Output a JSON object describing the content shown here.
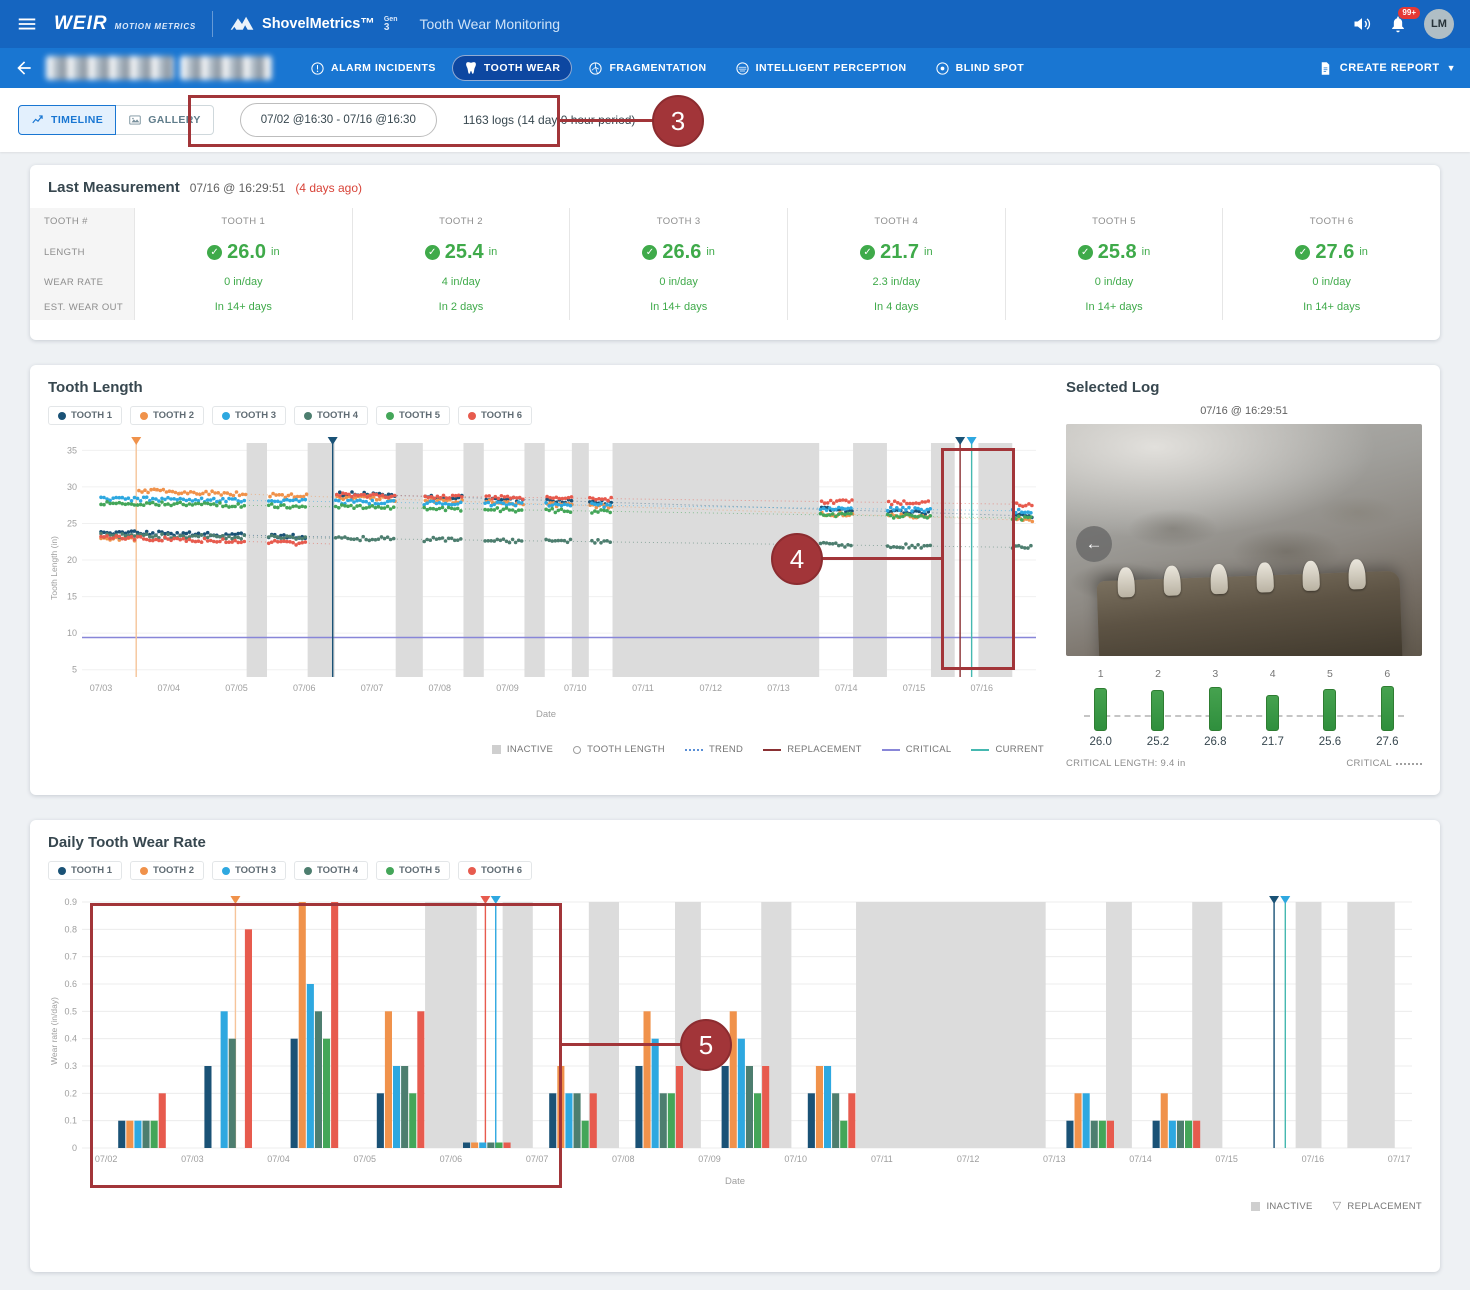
{
  "header": {
    "brand": "WEIR",
    "brand_sub": "MOTION METRICS",
    "product": "ShovelMetrics™",
    "product_gen_top": "Gen",
    "product_gen_num": "3",
    "page_title": "Tooth Wear Monitoring",
    "notification_badge": "99+",
    "avatar_initials": "LM"
  },
  "nav": {
    "items": [
      {
        "label": "ALARM INCIDENTS",
        "selected": false
      },
      {
        "label": "TOOTH WEAR",
        "selected": true
      },
      {
        "label": "FRAGMENTATION",
        "selected": false
      },
      {
        "label": "INTELLIGENT PERCEPTION",
        "selected": false
      },
      {
        "label": "BLIND SPOT",
        "selected": false
      }
    ],
    "create_report_label": "CREATE REPORT"
  },
  "toolbar": {
    "timeline_label": "TIMELINE",
    "gallery_label": "GALLERY",
    "date_range": "07/02 @16:30 - 07/16 @16:30",
    "log_summary": "1163 logs (14 day 0 hour period)"
  },
  "last_measurement": {
    "title": "Last Measurement",
    "timestamp": "07/16 @ 16:29:51",
    "ago": "(4 days ago)",
    "row_labels": [
      "TOOTH #",
      "LENGTH",
      "WEAR RATE",
      "EST. WEAR OUT"
    ],
    "teeth": [
      {
        "name": "TOOTH 1",
        "length": "26.0",
        "unit": "in",
        "rate": "0 in/day",
        "wearout": "In 14+ days"
      },
      {
        "name": "TOOTH 2",
        "length": "25.4",
        "unit": "in",
        "rate": "4 in/day",
        "wearout": "In 2 days"
      },
      {
        "name": "TOOTH 3",
        "length": "26.6",
        "unit": "in",
        "rate": "0 in/day",
        "wearout": "In 14+ days"
      },
      {
        "name": "TOOTH 4",
        "length": "21.7",
        "unit": "in",
        "rate": "2.3 in/day",
        "wearout": "In 4 days"
      },
      {
        "name": "TOOTH 5",
        "length": "25.8",
        "unit": "in",
        "rate": "0 in/day",
        "wearout": "In 14+ days"
      },
      {
        "name": "TOOTH 6",
        "length": "27.6",
        "unit": "in",
        "rate": "0 in/day",
        "wearout": "In 14+ days"
      }
    ]
  },
  "selected_log": {
    "title": "Selected Log",
    "timestamp": "07/16 @ 16:29:51",
    "teeth": [
      {
        "num": "1",
        "value": "26.0"
      },
      {
        "num": "2",
        "value": "25.2"
      },
      {
        "num": "3",
        "value": "26.8"
      },
      {
        "num": "4",
        "value": "21.7"
      },
      {
        "num": "5",
        "value": "25.6"
      },
      {
        "num": "6",
        "value": "27.6"
      }
    ],
    "critical_length": "CRITICAL LENGTH: 9.4 in",
    "critical_label": "CRITICAL"
  },
  "annotations": {
    "color": "#a23539",
    "labels": [
      "3",
      "4",
      "5"
    ]
  },
  "chart_data": [
    {
      "id": "tooth_length",
      "type": "scatter",
      "title": "Tooth Length",
      "xlabel": "Date",
      "ylabel": "Tooth Length (in)",
      "x_domain": [
        2.72,
        16.8
      ],
      "y_domain": [
        4,
        36
      ],
      "y_ticks": [
        5,
        10,
        15,
        20,
        25,
        30,
        35
      ],
      "x_tick_days": [
        3,
        4,
        5,
        6,
        7,
        8,
        9,
        10,
        11,
        12,
        13,
        14,
        15,
        16
      ],
      "x_tick_labels": [
        "07/03",
        "07/04",
        "07/05",
        "07/06",
        "07/07",
        "07/08",
        "07/09",
        "07/10",
        "07/11",
        "07/12",
        "07/13",
        "07/14",
        "07/15",
        "07/16"
      ],
      "critical_value": 9.4,
      "critical_color": "#8886d8",
      "current_x": 15.85,
      "inactive_color": "#dcdcdc",
      "inactive_bands": [
        [
          5.15,
          5.45
        ],
        [
          6.05,
          6.45
        ],
        [
          7.35,
          7.75
        ],
        [
          8.35,
          8.65
        ],
        [
          9.25,
          9.55
        ],
        [
          9.95,
          10.2
        ],
        [
          10.55,
          13.6
        ],
        [
          14.1,
          14.6
        ],
        [
          15.25,
          15.6
        ],
        [
          15.95,
          16.45
        ]
      ],
      "point_gaps": [
        [
          15.6,
          15.95
        ]
      ],
      "markers": [
        {
          "x": 3.52,
          "tri": "#f0924b",
          "line": "#f6c49a"
        },
        {
          "x": 6.42,
          "tri": "#1a5276",
          "line": "#1a5276"
        },
        {
          "x": 15.68,
          "tri": "#1a5276",
          "line": "#8a3033"
        },
        {
          "x": 15.85,
          "tri": "#2ea8e0",
          "line": "#45b8b0"
        }
      ],
      "series": [
        {
          "name": "TOOTH 1",
          "color": "#1a5276",
          "segments": [
            [
              3.0,
              23.8,
              6.4,
              23.15
            ],
            [
              6.48,
              29.1,
              16.75,
              26.0
            ]
          ]
        },
        {
          "name": "TOOTH 2",
          "color": "#f0924b",
          "segments": [
            [
              3.0,
              22.9,
              3.5,
              22.85
            ],
            [
              3.56,
              29.5,
              16.75,
              25.4
            ]
          ]
        },
        {
          "name": "TOOTH 3",
          "color": "#2ea8e0",
          "segments": [
            [
              3.0,
              28.4,
              16.75,
              26.7
            ]
          ]
        },
        {
          "name": "TOOTH 4",
          "color": "#4d7e6f",
          "segments": [
            [
              3.0,
              23.4,
              16.75,
              21.7
            ]
          ]
        },
        {
          "name": "TOOTH 5",
          "color": "#44a659",
          "segments": [
            [
              3.0,
              27.8,
              16.75,
              25.7
            ]
          ]
        },
        {
          "name": "TOOTH 6",
          "color": "#e75b4e",
          "segments": [
            [
              3.0,
              23.1,
              6.4,
              22.2
            ],
            [
              6.48,
              28.9,
              16.75,
              27.6
            ]
          ]
        }
      ],
      "legend_bottom": [
        {
          "glyph": "square",
          "label": "INACTIVE"
        },
        {
          "glyph": "circle",
          "label": "TOOTH LENGTH"
        },
        {
          "glyph": "dotted",
          "label": "TREND"
        },
        {
          "glyph": "line-dark",
          "label": "REPLACEMENT"
        },
        {
          "glyph": "line-purple",
          "label": "CRITICAL"
        },
        {
          "glyph": "line-teal",
          "label": "CURRENT"
        }
      ]
    },
    {
      "id": "wear_rate",
      "type": "bar",
      "title": "Daily Tooth Wear Rate",
      "xlabel": "Date",
      "ylabel": "Wear rate (in/day)",
      "x_domain": [
        1.72,
        17.15
      ],
      "y_domain": [
        0,
        0.9
      ],
      "y_ticks": [
        0,
        0.1,
        0.2,
        0.3,
        0.4,
        0.5,
        0.6,
        0.7,
        0.8,
        0.9
      ],
      "inactive_color": "#dcdcdc",
      "categories": [
        "07/02",
        "07/03",
        "07/04",
        "07/05",
        "07/06",
        "07/07",
        "07/08",
        "07/09",
        "07/10",
        "07/11",
        "07/12",
        "07/13",
        "07/14",
        "07/15",
        "07/16",
        "07/17"
      ],
      "inactive_bands": [
        [
          5.7,
          6.3
        ],
        [
          6.6,
          6.95
        ],
        [
          7.6,
          7.95
        ],
        [
          8.6,
          8.9
        ],
        [
          9.6,
          9.95
        ],
        [
          10.7,
          12.9
        ],
        [
          13.6,
          13.9
        ],
        [
          14.6,
          14.95
        ],
        [
          15.8,
          16.1
        ],
        [
          16.4,
          16.95
        ]
      ],
      "markers": [
        {
          "x": 3.5,
          "tri": "#f0924b",
          "line": "#f6c49a"
        },
        {
          "x": 6.4,
          "tri": "#e75b4e",
          "line": "#e75b4e"
        },
        {
          "x": 6.52,
          "tri": "#2ea8e0",
          "line": "#2ea8e0"
        },
        {
          "x": 15.55,
          "tri": "#1a5276",
          "line": "#1a5276"
        },
        {
          "x": 15.68,
          "tri": "#2ea8e0",
          "line": "#45b8b0"
        }
      ],
      "series": [
        {
          "name": "TOOTH 1",
          "color": "#1a5276",
          "values": [
            0.1,
            0.3,
            0.4,
            0.2,
            0.02,
            0.2,
            0.3,
            0.3,
            0.2,
            0,
            0,
            0.1,
            0.1,
            0,
            0,
            0
          ]
        },
        {
          "name": "TOOTH 2",
          "color": "#f0924b",
          "values": [
            0.1,
            0,
            0.9,
            0.5,
            0.02,
            0.3,
            0.5,
            0.5,
            0.3,
            0,
            0,
            0.2,
            0.2,
            0,
            0,
            0
          ]
        },
        {
          "name": "TOOTH 3",
          "color": "#2ea8e0",
          "values": [
            0.1,
            0.5,
            0.6,
            0.3,
            0.02,
            0.2,
            0.4,
            0.4,
            0.3,
            0,
            0,
            0.2,
            0.1,
            0,
            0,
            0
          ]
        },
        {
          "name": "TOOTH 4",
          "color": "#4d7e6f",
          "values": [
            0.1,
            0.4,
            0.5,
            0.3,
            0.02,
            0.2,
            0.2,
            0.3,
            0.2,
            0,
            0,
            0.1,
            0.1,
            0,
            0,
            0
          ]
        },
        {
          "name": "TOOTH 5",
          "color": "#44a659",
          "values": [
            0.1,
            0,
            0.4,
            0.2,
            0.02,
            0.1,
            0.2,
            0.2,
            0.1,
            0,
            0,
            0.1,
            0.1,
            0,
            0,
            0
          ]
        },
        {
          "name": "TOOTH 6",
          "color": "#e75b4e",
          "values": [
            0.2,
            0.8,
            0.9,
            0.5,
            0.02,
            0.2,
            0.3,
            0.3,
            0.2,
            0,
            0,
            0.1,
            0.1,
            0,
            0,
            0
          ]
        }
      ],
      "legend_bottom": [
        {
          "glyph": "square",
          "label": "INACTIVE"
        },
        {
          "glyph": "triangle",
          "label": "REPLACEMENT"
        }
      ]
    }
  ]
}
